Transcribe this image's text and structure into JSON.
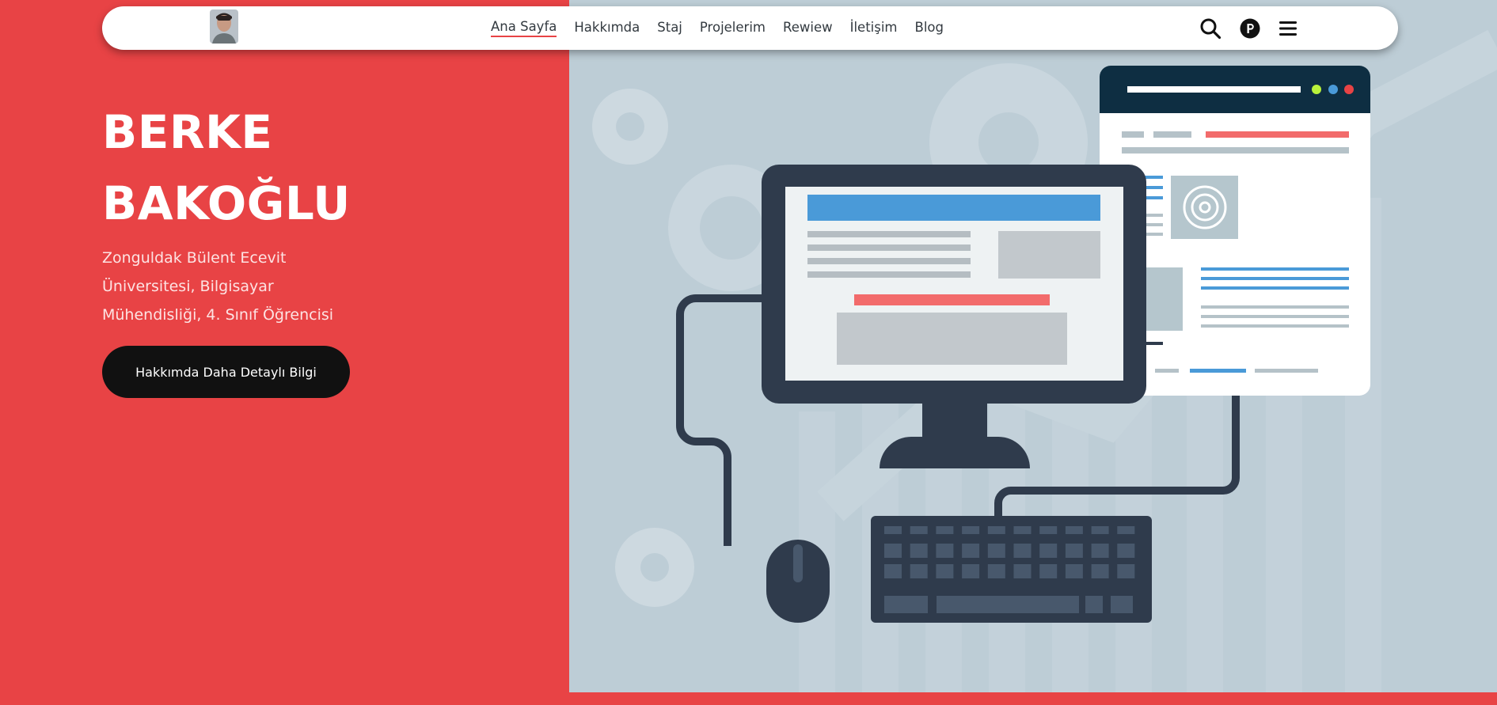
{
  "header": {
    "avatar_alt": "Profil fotoğrafı",
    "nav_links": [
      {
        "label": "Ana Sayfa",
        "active": true
      },
      {
        "label": "Hakkımda",
        "active": false
      },
      {
        "label": "Staj",
        "active": false
      },
      {
        "label": "Projelerim",
        "active": false
      },
      {
        "label": "Rewiew",
        "active": false
      },
      {
        "label": "İletişim",
        "active": false
      },
      {
        "label": "Blog",
        "active": false
      }
    ],
    "icons": [
      "search-icon",
      "p-badge-icon",
      "hamburger-menu-icon"
    ]
  },
  "hero": {
    "name_line1": "BERKE",
    "name_line2": "BAKOĞLU",
    "subtitle_line1": "Zonguldak Bülent Ecevit",
    "subtitle_line2": "Üniversitesi, Bilgisayar",
    "subtitle_line3": "Mühendisliği, 4. Sınıf Öğrencisi",
    "cta_label": "Hakkımda Daha Detaylı Bilgi"
  },
  "theme": {
    "accent": "#e84345",
    "illustration_bg": "#bdcdd6",
    "dark": "#111111",
    "navy": "#2f3b4c",
    "blue": "#4a9ad8"
  }
}
